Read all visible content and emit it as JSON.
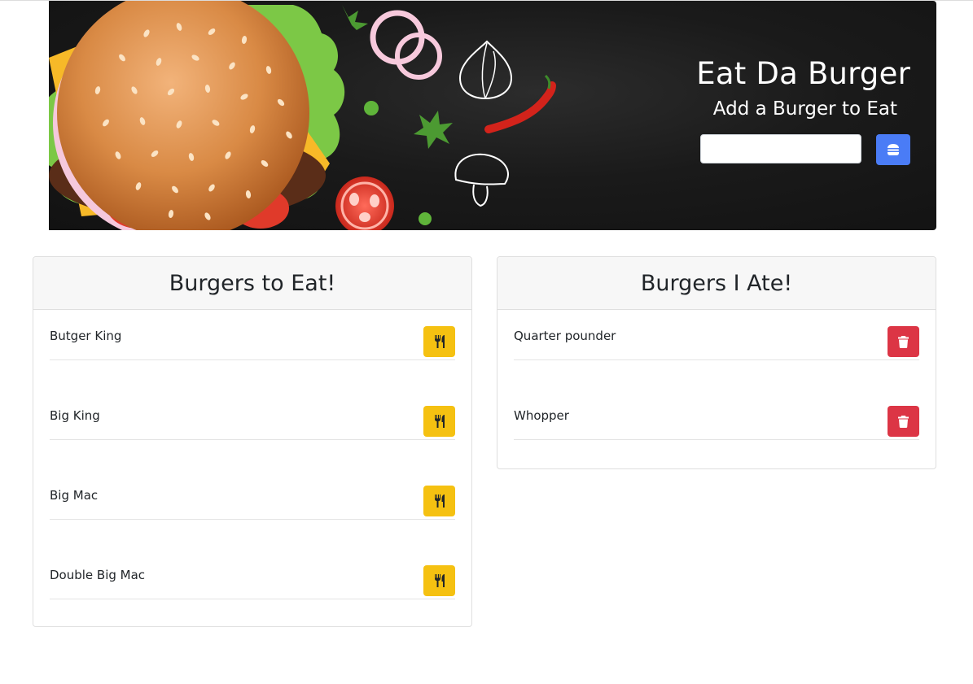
{
  "header": {
    "title": "Eat Da Burger",
    "subtitle": "Add a Burger to Eat",
    "input_value": "",
    "submit_icon": "burger-icon"
  },
  "colors": {
    "submit_button": "#4a7cf6",
    "devour_button": "#f5c111",
    "delete_button": "#dc3545",
    "banner_background": "#1a1a1a"
  },
  "to_eat": {
    "title": "Burgers to Eat!",
    "action_icon": "utensils-icon",
    "items": [
      {
        "name": "Butger King"
      },
      {
        "name": "Big King"
      },
      {
        "name": "Big Mac"
      },
      {
        "name": "Double Big Mac"
      }
    ]
  },
  "eaten": {
    "title": "Burgers I Ate!",
    "action_icon": "trash-icon",
    "items": [
      {
        "name": "Quarter pounder"
      },
      {
        "name": "Whopper"
      }
    ]
  }
}
